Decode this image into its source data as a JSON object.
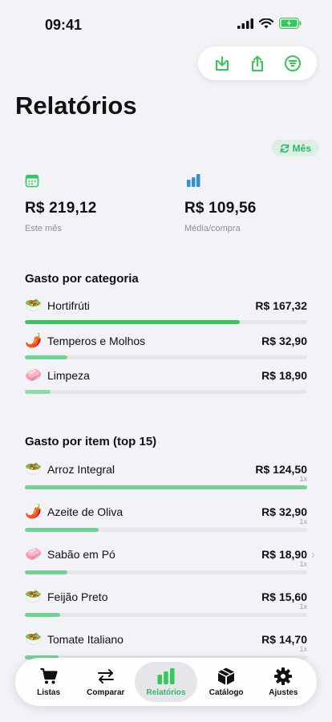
{
  "status": {
    "time": "09:41"
  },
  "header": {
    "title": "Relatórios",
    "period": "Mês"
  },
  "stats": [
    {
      "value": "R$ 219,12",
      "label": "Este mês"
    },
    {
      "value": "R$ 109,56",
      "label": "Média/compra"
    }
  ],
  "categories": {
    "title": "Gasto por categoria",
    "items": [
      {
        "emoji": "🥗",
        "name": "Hortifrúti",
        "amount": "R$ 167,32",
        "fraction": 0.76,
        "color": "#34c759"
      },
      {
        "emoji": "🌶️",
        "name": "Temperos e Molhos",
        "amount": "R$ 32,90",
        "fraction": 0.15,
        "color": "#6fd393"
      },
      {
        "emoji": "🧼",
        "name": "Limpeza",
        "amount": "R$ 18,90",
        "fraction": 0.09,
        "color": "#8fdcab"
      }
    ]
  },
  "items": {
    "title": "Gasto por item (top 15)",
    "list": [
      {
        "emoji": "🥗",
        "name": "Arroz Integral",
        "amount": "R$ 124,50",
        "qty": "1x",
        "fraction": 1.0
      },
      {
        "emoji": "🌶️",
        "name": "Azeite de Oliva",
        "amount": "R$ 32,90",
        "qty": "1x",
        "fraction": 0.26
      },
      {
        "emoji": "🧼",
        "name": "Sabão em Pó",
        "amount": "R$ 18,90",
        "qty": "1x",
        "fraction": 0.15
      },
      {
        "emoji": "🥗",
        "name": "Feijão Preto",
        "amount": "R$ 15,60",
        "qty": "1x",
        "fraction": 0.125
      },
      {
        "emoji": "🥗",
        "name": "Tomate Italiano",
        "amount": "R$ 14,70",
        "qty": "1x",
        "fraction": 0.118
      }
    ]
  },
  "tabs": [
    {
      "label": "Listas",
      "icon": "cart-icon"
    },
    {
      "label": "Comparar",
      "icon": "arrows-icon"
    },
    {
      "label": "Relatórios",
      "icon": "chart-icon"
    },
    {
      "label": "Catálogo",
      "icon": "box-icon"
    },
    {
      "label": "Ajustes",
      "icon": "gear-icon"
    }
  ],
  "colors": {
    "accent": "#34c759",
    "accent_text": "#2fb866",
    "stat_icon": "#34c759",
    "stat_icon_2": "#2f8ee0"
  }
}
